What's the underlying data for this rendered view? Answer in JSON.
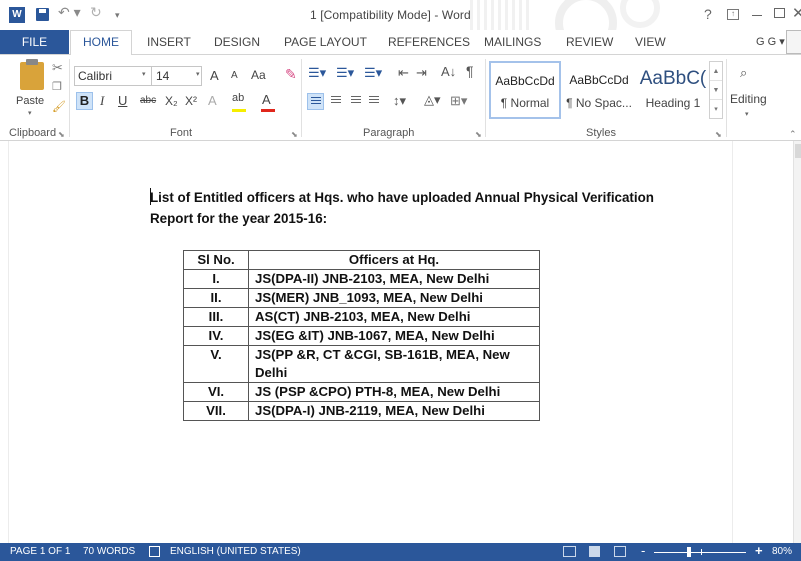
{
  "titlebar": {
    "word_logo": "W",
    "title": "1 [Compatibility Mode] - Word",
    "help": "?",
    "icons": [
      "word-icon",
      "save-icon",
      "undo-icon",
      "redo-icon",
      "help-icon",
      "ribbon-display-icon",
      "minimize-icon",
      "maximize-icon",
      "close-icon"
    ]
  },
  "tabs": {
    "file": "FILE",
    "home": "HOME",
    "insert": "INSERT",
    "design": "DESIGN",
    "page_layout": "PAGE LAYOUT",
    "references": "REFERENCES",
    "mailings": "MAILINGS",
    "review": "REVIEW",
    "view": "VIEW",
    "user": "G G"
  },
  "ribbon": {
    "clipboard": {
      "paste": "Paste",
      "label": "Clipboard"
    },
    "font": {
      "name": "Calibri",
      "size": "14",
      "grow": "A",
      "shrink": "A",
      "case": "Aa",
      "bold": "B",
      "italic": "I",
      "underline": "U",
      "strike": "abc",
      "subscript": "X₂",
      "superscript": "X²",
      "effects": "A",
      "highlight": "ab",
      "font_color": "A",
      "label": "Font"
    },
    "paragraph": {
      "label": "Paragraph",
      "sort": "A↓",
      "pilcrow": "¶"
    },
    "styles": {
      "items": [
        {
          "sample": "AaBbCcDd",
          "name": "¶ Normal"
        },
        {
          "sample": "AaBbCcDd",
          "name": "¶ No Spac..."
        },
        {
          "sample": "AaBbC(",
          "name": "Heading 1"
        }
      ],
      "label": "Styles"
    },
    "editing": {
      "label": "Editing"
    }
  },
  "document": {
    "heading": "List of Entitled officers at Hqs. who have uploaded Annual Physical Verification Report for the year 2015-16:",
    "table": {
      "headers": [
        "Sl No.",
        "Officers at Hq."
      ],
      "rows": [
        [
          "I.",
          "JS(DPA-II) JNB-2103, MEA, New Delhi"
        ],
        [
          "II.",
          "JS(MER) JNB_1093, MEA, New Delhi"
        ],
        [
          "III.",
          "AS(CT) JNB-2103, MEA, New Delhi"
        ],
        [
          "IV.",
          "JS(EG &IT) JNB-1067, MEA, New Delhi"
        ],
        [
          "V.",
          "JS(PP &R, CT &CGI, SB-161B, MEA, New Delhi"
        ],
        [
          "VI.",
          "JS (PSP &CPO) PTH-8, MEA, New Delhi"
        ],
        [
          "VII.",
          "JS(DPA-I) JNB-2119, MEA, New Delhi"
        ]
      ]
    }
  },
  "statusbar": {
    "page": "PAGE 1 OF 1",
    "words": "70 WORDS",
    "language": "ENGLISH (UNITED STATES)",
    "zoom_minus": "-",
    "zoom_plus": "+",
    "zoom": "80%",
    "zoom_value_percent": 80
  },
  "colors": {
    "accent": "#2b579a",
    "highlight": "#f6ee00",
    "font_color": "#e0261b"
  }
}
